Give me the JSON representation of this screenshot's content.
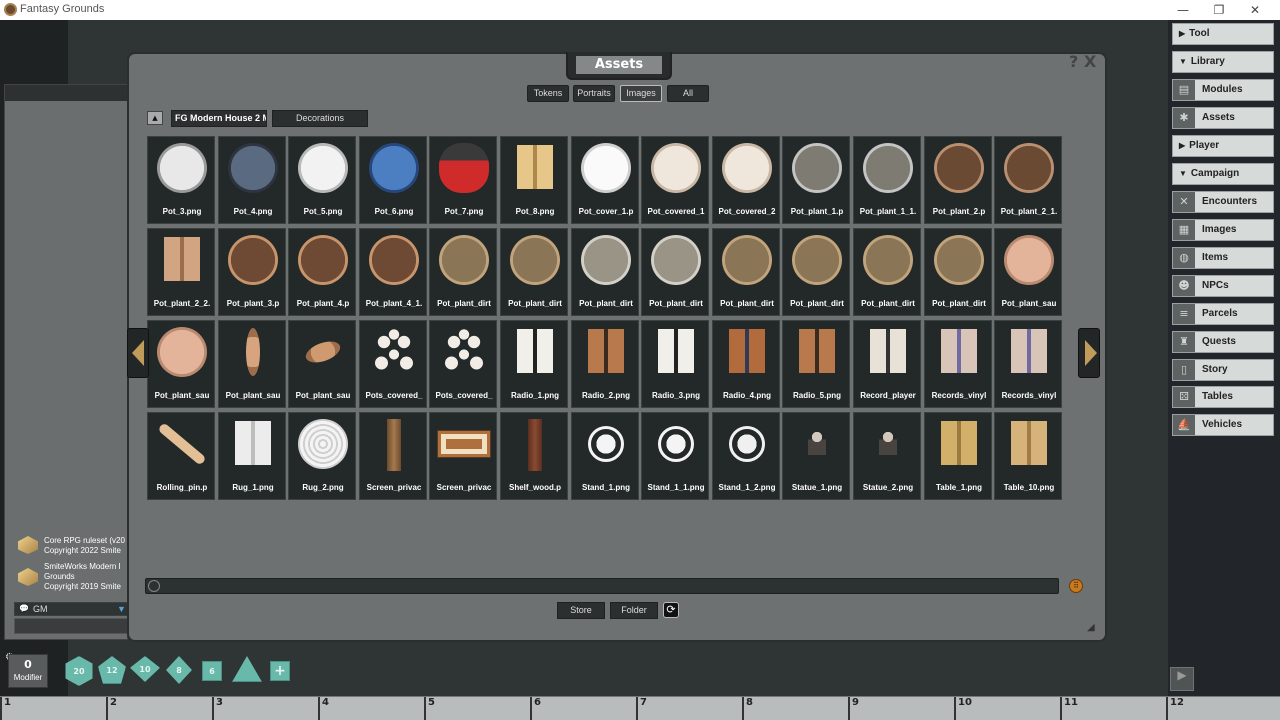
{
  "window": {
    "title": "Fantasy Grounds",
    "minimize": "—",
    "restore": "❐",
    "close": "✕"
  },
  "assets": {
    "title": "Assets",
    "help": "?",
    "close": "X",
    "filters": [
      "Tokens",
      "Portraits",
      "Images",
      "All"
    ],
    "active_filter": "Images",
    "breadcrumb": [
      "FG Modern House 2 Ma",
      "Decorations"
    ],
    "store_label": "Store",
    "folder_label": "Folder",
    "items": [
      {
        "label": "Pot_3.png",
        "type": "pot-white"
      },
      {
        "label": "Pot_4.png",
        "type": "pot-dark"
      },
      {
        "label": "Pot_5.png",
        "type": "pot-white-handle"
      },
      {
        "label": "Pot_6.png",
        "type": "pot-blue"
      },
      {
        "label": "Pot_7.png",
        "type": "pot-red"
      },
      {
        "label": "Pot_8.png",
        "type": "pot-yellow"
      },
      {
        "label": "Pot_cover_1.p",
        "type": "pot-cover"
      },
      {
        "label": "Pot_covered_1",
        "type": "pot-covered"
      },
      {
        "label": "Pot_covered_2",
        "type": "pot-covered"
      },
      {
        "label": "Pot_plant_1.p",
        "type": "pot-plant-grey"
      },
      {
        "label": "Pot_plant_1_1.",
        "type": "pot-plant-grey"
      },
      {
        "label": "Pot_plant_2.p",
        "type": "pot-plant-brown"
      },
      {
        "label": "Pot_plant_2_1.",
        "type": "pot-plant-brown"
      },
      {
        "label": "Pot_plant_2_2.",
        "type": "pot-plant-side"
      },
      {
        "label": "Pot_plant_3.p",
        "type": "pot-plant-terra"
      },
      {
        "label": "Pot_plant_4.p",
        "type": "pot-plant-terra"
      },
      {
        "label": "Pot_plant_4_1.",
        "type": "pot-plant-terra"
      },
      {
        "label": "Pot_plant_dirt",
        "type": "pot-dirt"
      },
      {
        "label": "Pot_plant_dirt",
        "type": "pot-dirt"
      },
      {
        "label": "Pot_plant_dirt",
        "type": "pot-dirt-grey"
      },
      {
        "label": "Pot_plant_dirt",
        "type": "pot-dirt-grey"
      },
      {
        "label": "Pot_plant_dirt",
        "type": "pot-dirt"
      },
      {
        "label": "Pot_plant_dirt",
        "type": "pot-dirt"
      },
      {
        "label": "Pot_plant_dirt",
        "type": "pot-dirt"
      },
      {
        "label": "Pot_plant_dirt",
        "type": "pot-dirt"
      },
      {
        "label": "Pot_plant_sau",
        "type": "saucer"
      },
      {
        "label": "Pot_plant_sau",
        "type": "saucer"
      },
      {
        "label": "Pot_plant_sau",
        "type": "saucer-side"
      },
      {
        "label": "Pot_plant_sau",
        "type": "saucer-tilt"
      },
      {
        "label": "Pots_covered_",
        "type": "pots-group"
      },
      {
        "label": "Pots_covered_",
        "type": "pots-group"
      },
      {
        "label": "Radio_1.png",
        "type": "radio-small"
      },
      {
        "label": "Radio_2.png",
        "type": "radio"
      },
      {
        "label": "Radio_3.png",
        "type": "radio-small"
      },
      {
        "label": "Radio_4.png",
        "type": "radio-big"
      },
      {
        "label": "Radio_5.png",
        "type": "radio"
      },
      {
        "label": "Record_player",
        "type": "record-player"
      },
      {
        "label": "Records_vinyl",
        "type": "records"
      },
      {
        "label": "Records_vinyl",
        "type": "records"
      },
      {
        "label": "Rolling_pin.p",
        "type": "rolling-pin"
      },
      {
        "label": "Rug_1.png",
        "type": "rug-white"
      },
      {
        "label": "Rug_2.png",
        "type": "rug-lace"
      },
      {
        "label": "Screen_privac",
        "type": "screen-thin"
      },
      {
        "label": "Screen_privac",
        "type": "screen-wide"
      },
      {
        "label": "Shelf_wood.p",
        "type": "shelf"
      },
      {
        "label": "Stand_1.png",
        "type": "stand"
      },
      {
        "label": "Stand_1_1.png",
        "type": "stand"
      },
      {
        "label": "Stand_1_2.png",
        "type": "stand-side"
      },
      {
        "label": "Statue_1.png",
        "type": "statue"
      },
      {
        "label": "Statue_2.png",
        "type": "statue"
      },
      {
        "label": "Table_1.png",
        "type": "table-tall"
      },
      {
        "label": "Table_10.png",
        "type": "table-square"
      }
    ]
  },
  "chat": {
    "entries": [
      {
        "line1": "Core RPG ruleset (v20",
        "line2": "Copyright 2022 Smite"
      },
      {
        "line1": "SmiteWorks Modern I",
        "line2": "Grounds",
        "line3": "Copyright 2019 Smite"
      }
    ],
    "identity": "GM"
  },
  "modifier": {
    "value": "0",
    "label": "Modifier"
  },
  "dice": [
    "20",
    "12",
    "10",
    "8",
    "6",
    "4",
    "+"
  ],
  "hotkeys": [
    "1",
    "2",
    "3",
    "4",
    "5",
    "6",
    "7",
    "8",
    "9",
    "10",
    "11",
    "12"
  ],
  "sidebar": {
    "headers": [
      {
        "label": "Tool",
        "arrow": "▶"
      },
      {
        "label": "Library",
        "arrow": "▼"
      },
      {
        "label": "Player",
        "arrow": "▶"
      },
      {
        "label": "Campaign",
        "arrow": "▼"
      }
    ],
    "library_items": [
      {
        "label": "Modules",
        "icon": "▤"
      },
      {
        "label": "Assets",
        "icon": "✱"
      }
    ],
    "campaign_items": [
      {
        "label": "Encounters",
        "icon": "✕"
      },
      {
        "label": "Images",
        "icon": "▦"
      },
      {
        "label": "Items",
        "icon": "◍"
      },
      {
        "label": "NPCs",
        "icon": "☻"
      },
      {
        "label": "Parcels",
        "icon": "≡"
      },
      {
        "label": "Quests",
        "icon": "♜"
      },
      {
        "label": "Story",
        "icon": "▯"
      },
      {
        "label": "Tables",
        "icon": "⚄"
      },
      {
        "label": "Vehicles",
        "icon": "⛵"
      }
    ]
  }
}
